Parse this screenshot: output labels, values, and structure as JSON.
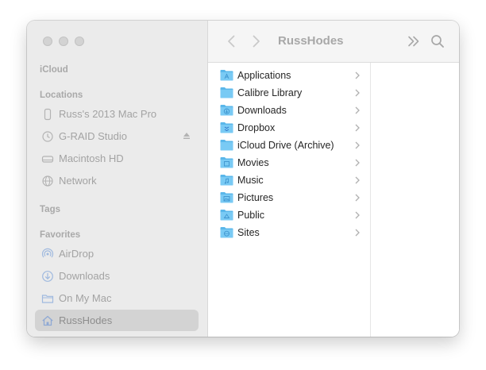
{
  "window": {
    "title": "RussHodes"
  },
  "sidebar": {
    "icloud_label": "iCloud",
    "locations_label": "Locations",
    "locations": [
      {
        "label": "Russ's 2013 Mac Pro",
        "icon": "desktop-computer-icon"
      },
      {
        "label": "G-RAID Studio",
        "icon": "time-machine-icon",
        "ejectable": true
      },
      {
        "label": "Macintosh HD",
        "icon": "hard-drive-icon"
      },
      {
        "label": "Network",
        "icon": "globe-icon"
      }
    ],
    "tags_label": "Tags",
    "favorites_label": "Favorites",
    "favorites": [
      {
        "label": "AirDrop",
        "icon": "airdrop-icon"
      },
      {
        "label": "Downloads",
        "icon": "download-circle-icon"
      },
      {
        "label": "On My Mac",
        "icon": "folder-outline-icon"
      },
      {
        "label": "RussHodes",
        "icon": "home-icon",
        "selected": true
      }
    ]
  },
  "toolbar": {
    "back_icon": "chevron-left-icon",
    "forward_icon": "chevron-right-icon",
    "more_icon": "double-chevron-right-icon",
    "search_icon": "search-icon"
  },
  "column": {
    "items": [
      {
        "label": "Applications"
      },
      {
        "label": "Calibre Library"
      },
      {
        "label": "Downloads"
      },
      {
        "label": "Dropbox"
      },
      {
        "label": "iCloud Drive (Archive)"
      },
      {
        "label": "Movies"
      },
      {
        "label": "Music"
      },
      {
        "label": "Pictures"
      },
      {
        "label": "Public"
      },
      {
        "label": "Sites"
      }
    ]
  },
  "colors": {
    "folder_blue": "#5ab7ea",
    "sidebar_bg": "#ebebeb",
    "selected_bg": "#d3d3d3"
  }
}
